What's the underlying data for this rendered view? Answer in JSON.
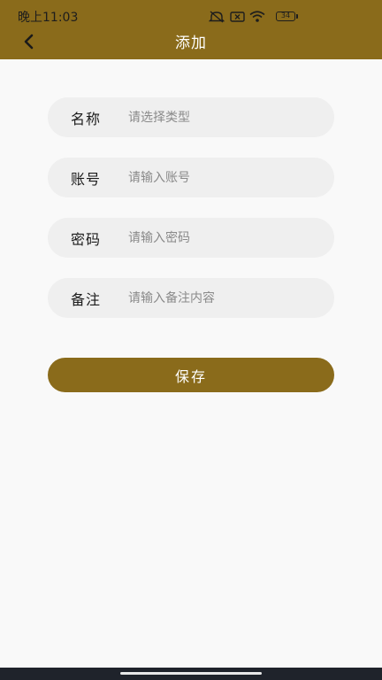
{
  "status_bar": {
    "time": "晚上11:03",
    "battery": "34",
    "icons": [
      "mute-icon",
      "sim-none-icon",
      "wifi-icon",
      "battery-icon"
    ]
  },
  "nav": {
    "title": "添加",
    "back_icon": "chevron-left-icon"
  },
  "form": {
    "fields": [
      {
        "label": "名称",
        "placeholder": "请选择类型",
        "value": ""
      },
      {
        "label": "账号",
        "placeholder": "请输入账号",
        "value": ""
      },
      {
        "label": "密码",
        "placeholder": "请输入密码",
        "value": ""
      },
      {
        "label": "备注",
        "placeholder": "请输入备注内容",
        "value": ""
      }
    ],
    "save_label": "保存"
  },
  "colors": {
    "brand": "#8a6b1b",
    "field_bg": "#efefef",
    "page_bg": "#f9f9f9"
  }
}
